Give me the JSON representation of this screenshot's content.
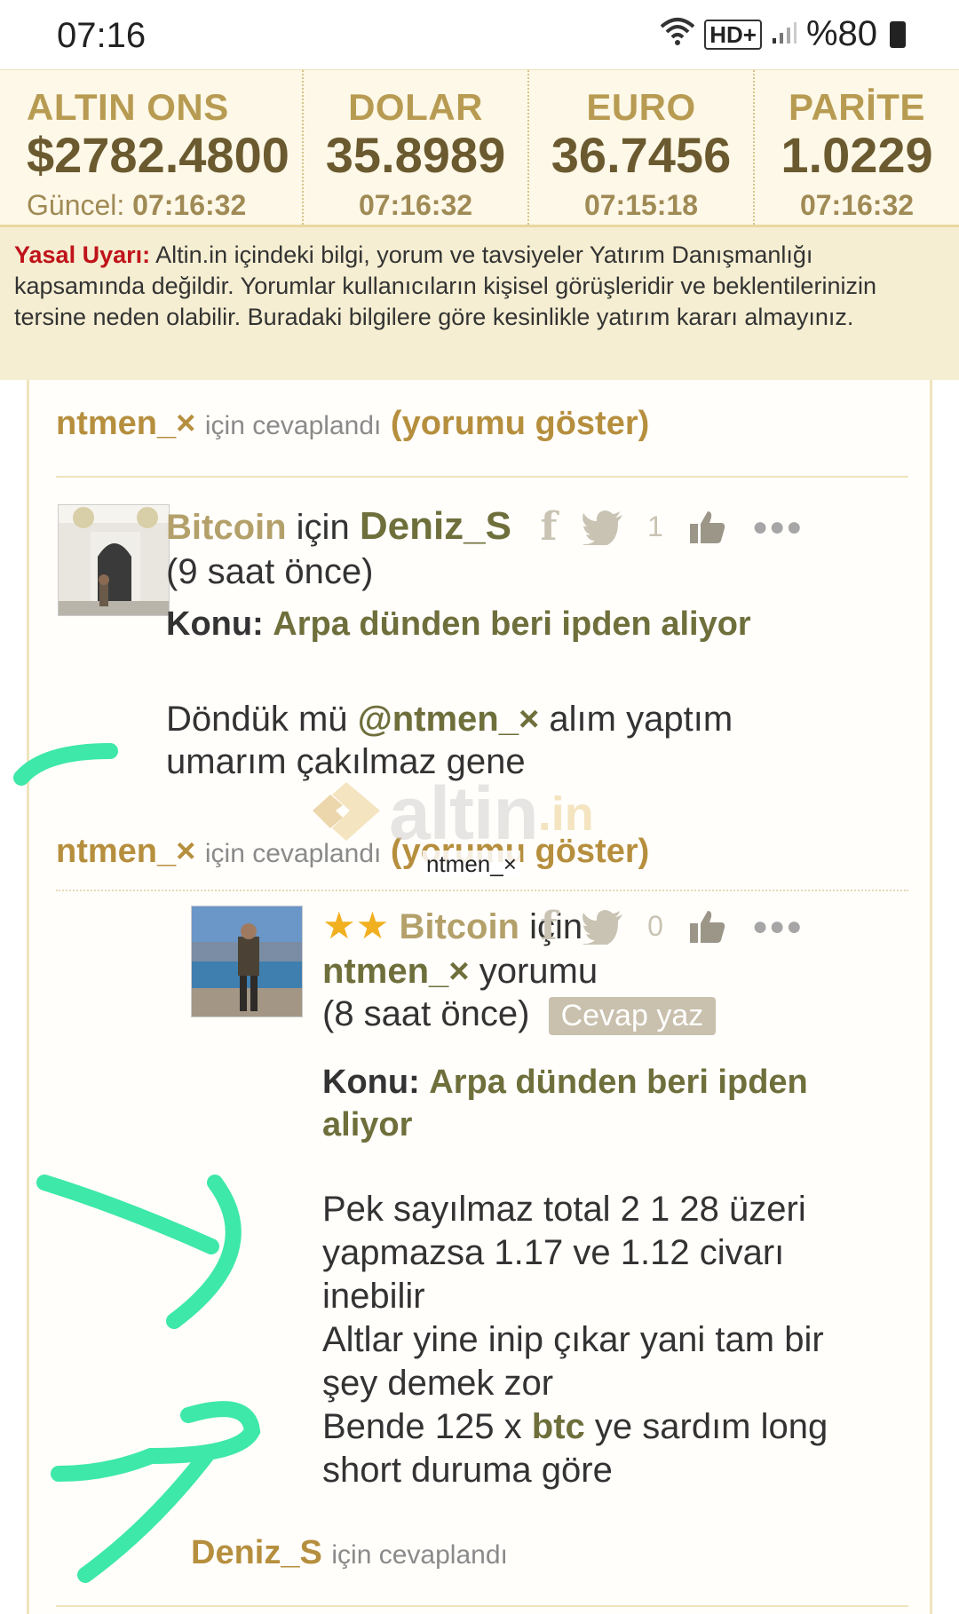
{
  "status_bar": {
    "time": "07:16",
    "network": "HD+",
    "battery": "%80"
  },
  "ticker": [
    {
      "label": "ALTIN ONS",
      "value": "$2782.4800",
      "time_label": "Güncel:",
      "time": "07:16:32"
    },
    {
      "label": "DOLAR",
      "value": "35.8989",
      "time": "07:16:32"
    },
    {
      "label": "EURO",
      "value": "36.7456",
      "time": "07:15:18"
    },
    {
      "label": "PARİTE",
      "value": "1.0229",
      "time": "07:16:32"
    }
  ],
  "warning": {
    "title": "Yasal Uyarı:",
    "text": "Altin.in içindeki bilgi, yorum ve tavsiyeler Yatırım Danışmanlığı kapsamında değildir. Yorumlar kullanıcıların kişisel görüşleridir ve beklentilerinizin tersine neden olabilir. Buradaki bilgilere göre kesinlikle yatırım kararı almayınız."
  },
  "reply_header_1": {
    "user": "ntmen_×",
    "text": "için cevaplandı",
    "link": "(yorumu göster)"
  },
  "comment_1": {
    "symbol": "Bitcoin",
    "for_text": "için",
    "author": "Deniz_S",
    "time_ago": "(9 saat önce)",
    "likes": "1",
    "topic_label": "Konu:",
    "topic": "Arpa dünden beri ipden aliyor",
    "body_part1": "Döndük mü",
    "mention": "@ntmen_×",
    "body_part2": "alım yaptım",
    "body_line2": "umarım çakılmaz gene"
  },
  "reply_header_2": {
    "user": "ntmen_×",
    "text": "için cevaplandı",
    "link": "(yorumu göster)"
  },
  "watermark": {
    "main": "altin",
    "suffix": ".in"
  },
  "tooltip": "ntmen_×",
  "comment_2": {
    "stars": "★★",
    "symbol": "Bitcoin",
    "for_text": "için",
    "author": "ntmen_×",
    "author_suffix": "yorumu",
    "time_ago": "(8 saat önce)",
    "reply_button": "Cevap yaz",
    "likes": "0",
    "topic_label": "Konu:",
    "topic_line1": "Arpa dünden beri ipden",
    "topic_line2": "aliyor",
    "body_lines": [
      "Pek sayılmaz total 2 1 28 üzeri",
      "yapmazsa 1.17 ve 1.12 civarı",
      "inebilir",
      "Altlar yine inip çıkar yani tam bir",
      "şey demek zor"
    ],
    "body_last_pre": "Bende 125 x",
    "body_last_tag": "btc",
    "body_last_post": "ye sardım long",
    "body_final": "short duruma göre"
  },
  "reply_header_3": {
    "user": "Deniz_S",
    "text": "için cevaplandı"
  },
  "colors": {
    "ticker_bg": "#fdf8e8",
    "warning_bg": "#f5eed2",
    "gold": "#b68f3e",
    "olive": "#6e6f3b",
    "warning_red": "#c0131a",
    "annotation_green": "#3de8a8"
  }
}
